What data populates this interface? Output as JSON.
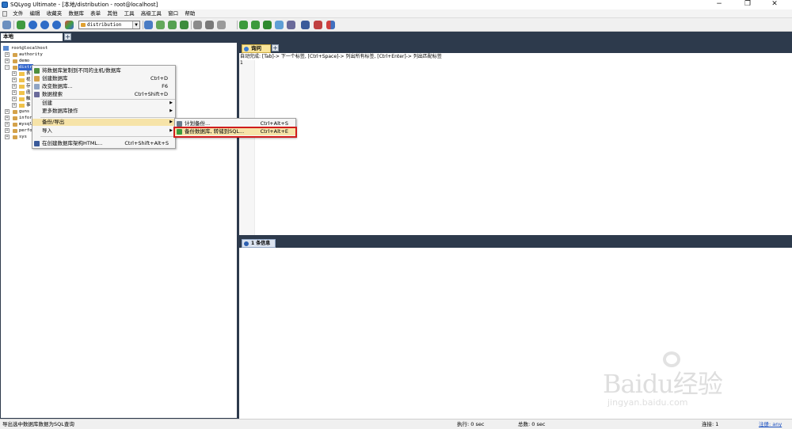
{
  "window": {
    "title": "SQLyog Ultimate - [本地/distribution - root@localhost]",
    "controls": [
      "−",
      "❐",
      "✕"
    ]
  },
  "menu": [
    "文件",
    "编辑",
    "收藏夹",
    "数据库",
    "表单",
    "其他",
    "工具",
    "高级工具",
    "窗口",
    "帮助"
  ],
  "toolbar": {
    "selected_database": "distribution"
  },
  "connection_tabs": {
    "active": "本地",
    "add": "+"
  },
  "tree": {
    "root": "root@localhost",
    "databases": [
      "authority",
      "demo",
      "distr",
      "guns",
      "infor",
      "mysql",
      "perfo",
      "sys"
    ],
    "children": [
      "表",
      "视",
      "存",
      "函",
      "触",
      "事"
    ]
  },
  "editor": {
    "tab_label": "询问",
    "add": "+",
    "autocomplete_hint": "自动完成: [Tab]-> 下一个标签, [Ctrl+Space]-> 列出所有标签, [Ctrl+Enter]-> 列出匹配标签",
    "line_number": "1"
  },
  "info_panel": {
    "tab_label": "1 条信息"
  },
  "context_menu": {
    "items": [
      {
        "label": "将数据库复制到不同的主机/数据库",
        "shortcut": ""
      },
      {
        "label": "创建数据库",
        "shortcut": "Ctrl+D"
      },
      {
        "label": "改变数据库...",
        "shortcut": "F6"
      },
      {
        "label": "数据搜索",
        "shortcut": "Ctrl+Shift+D"
      },
      {
        "label": "创建",
        "shortcut": "",
        "submenu": true
      },
      {
        "label": "更多数据库操作",
        "shortcut": "",
        "submenu": true
      },
      {
        "label": "备份/导出",
        "shortcut": "",
        "submenu": true
      },
      {
        "label": "导入",
        "shortcut": "",
        "submenu": true
      },
      {
        "label": "在创建数据库架构HTML...",
        "shortcut": "Ctrl+Shift+Alt+S"
      }
    ]
  },
  "submenu": {
    "items": [
      {
        "label": "计划备份...",
        "shortcut": "Ctrl+Alt+S"
      },
      {
        "label": "备份数据库, 转储到SQL...",
        "shortcut": "Ctrl+Alt+E"
      }
    ]
  },
  "status": {
    "message": "导出选中数据库数据为SQL查询",
    "exec_time": "执行: 0 sec",
    "total_time": "总数: 0 sec",
    "connections": "连接: 1",
    "register": "注册: any"
  },
  "watermark": {
    "brand": "Baidu经验",
    "url": "jingyan.baidu.com"
  },
  "colors": {
    "panel_frame": "#2d3a4c",
    "tree_highlight": "#3366cc",
    "menu_highlight": "#f6e3a8",
    "callout_border": "#d01c1c"
  }
}
